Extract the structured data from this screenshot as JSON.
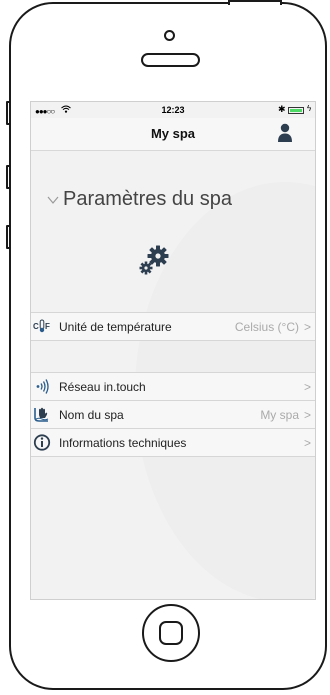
{
  "status_bar": {
    "signal": "●●●○○",
    "time": "12:23",
    "bluetooth": "✱",
    "charge": "ϟ"
  },
  "navbar": {
    "title": "My spa",
    "user_icon": "user-icon"
  },
  "section": {
    "title": "Paramètres du spa",
    "icon": "gears-icon"
  },
  "settings": {
    "temperature_unit": {
      "label": "Unité de température",
      "value": "Celsius (°C)",
      "icon": "thermometer-cf-icon"
    },
    "network": {
      "label": "Réseau in.touch",
      "value": "",
      "icon": "wifi-signal-icon"
    },
    "spa_name": {
      "label": "Nom du spa",
      "value": "My spa",
      "icon": "spa-hand-icon"
    },
    "tech_info": {
      "label": "Informations techniques",
      "value": "",
      "icon": "info-icon"
    }
  },
  "chevron": ">",
  "colors": {
    "screen_bg": "#f2f2f2",
    "row_bg": "#f7f7f7",
    "accent_icon": "#2a5d8c",
    "battery": "#4cd964"
  }
}
